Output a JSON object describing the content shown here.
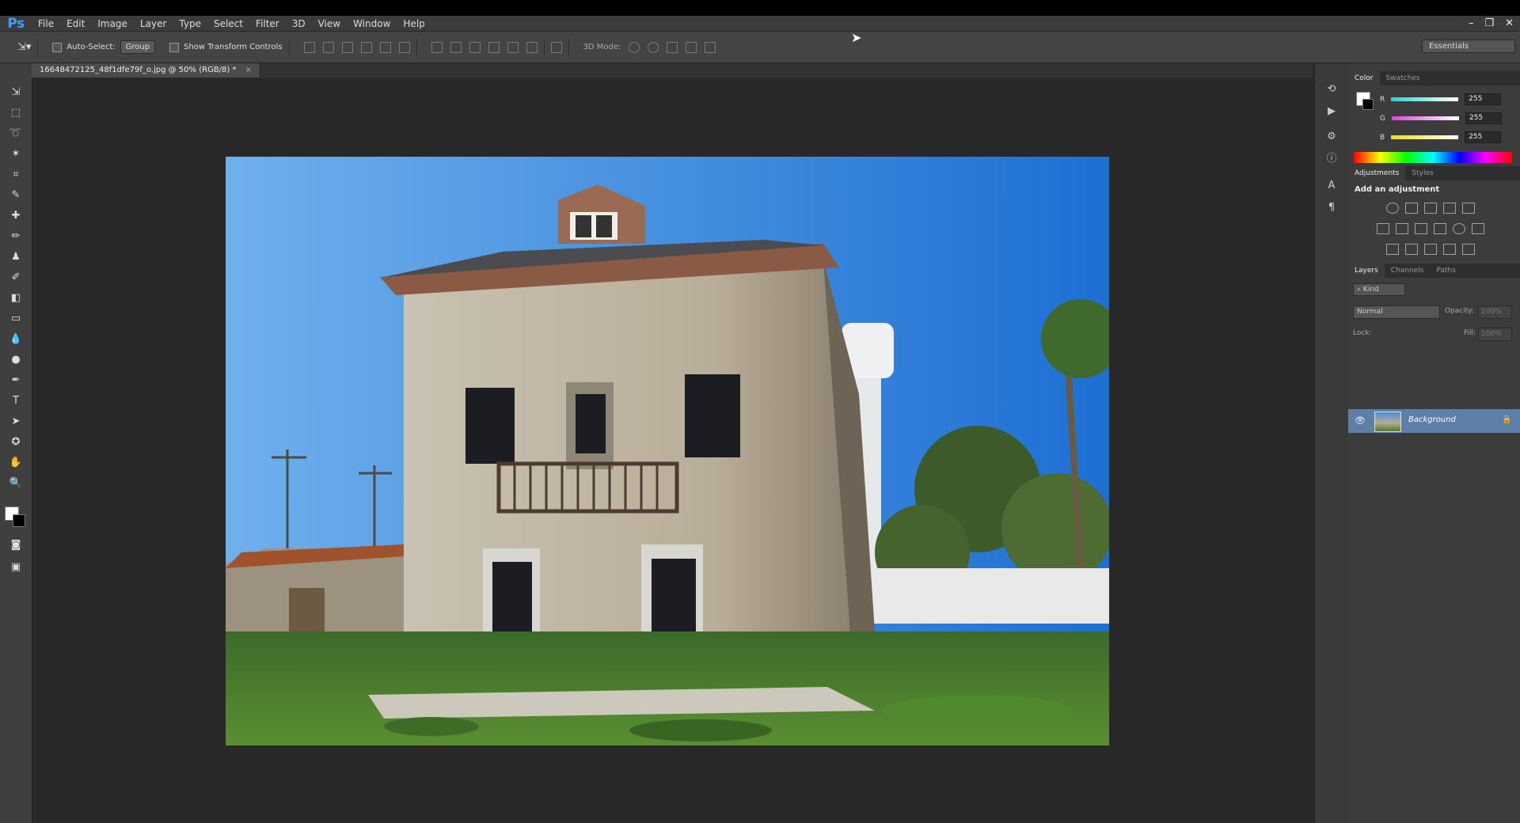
{
  "app": {
    "logo": "Ps"
  },
  "menu": [
    "File",
    "Edit",
    "Image",
    "Layer",
    "Type",
    "Select",
    "Filter",
    "3D",
    "View",
    "Window",
    "Help"
  ],
  "window_controls": {
    "minimize": "–",
    "restore": "❐",
    "close": "✕"
  },
  "options": {
    "auto_select_label": "Auto-Select:",
    "auto_select_value": "Group",
    "show_transform_label": "Show Transform Controls",
    "mode_3d_label": "3D Mode:",
    "workspace": "Essentials"
  },
  "document": {
    "tab_title": "16648472125_48f1dfe79f_o.jpg @ 50% (RGB/8) *",
    "close": "×"
  },
  "color_panel": {
    "tabs": [
      "Color",
      "Swatches"
    ],
    "channels": [
      {
        "label": "R",
        "value": "255",
        "color": "#2fd0d0"
      },
      {
        "label": "G",
        "value": "255",
        "color": "#e040e0"
      },
      {
        "label": "B",
        "value": "255",
        "color": "#e6e020"
      }
    ]
  },
  "adjustments_panel": {
    "tabs": [
      "Adjustments",
      "Styles"
    ],
    "heading": "Add an adjustment"
  },
  "layers_panel": {
    "tabs": [
      "Layers",
      "Channels",
      "Paths"
    ],
    "filter_label": "Kind",
    "blend_mode": "Normal",
    "opacity_label": "Opacity:",
    "opacity_value": "100%",
    "lock_label": "Lock:",
    "fill_label": "Fill:",
    "fill_value": "100%",
    "layers": [
      {
        "name": "Background"
      }
    ]
  }
}
